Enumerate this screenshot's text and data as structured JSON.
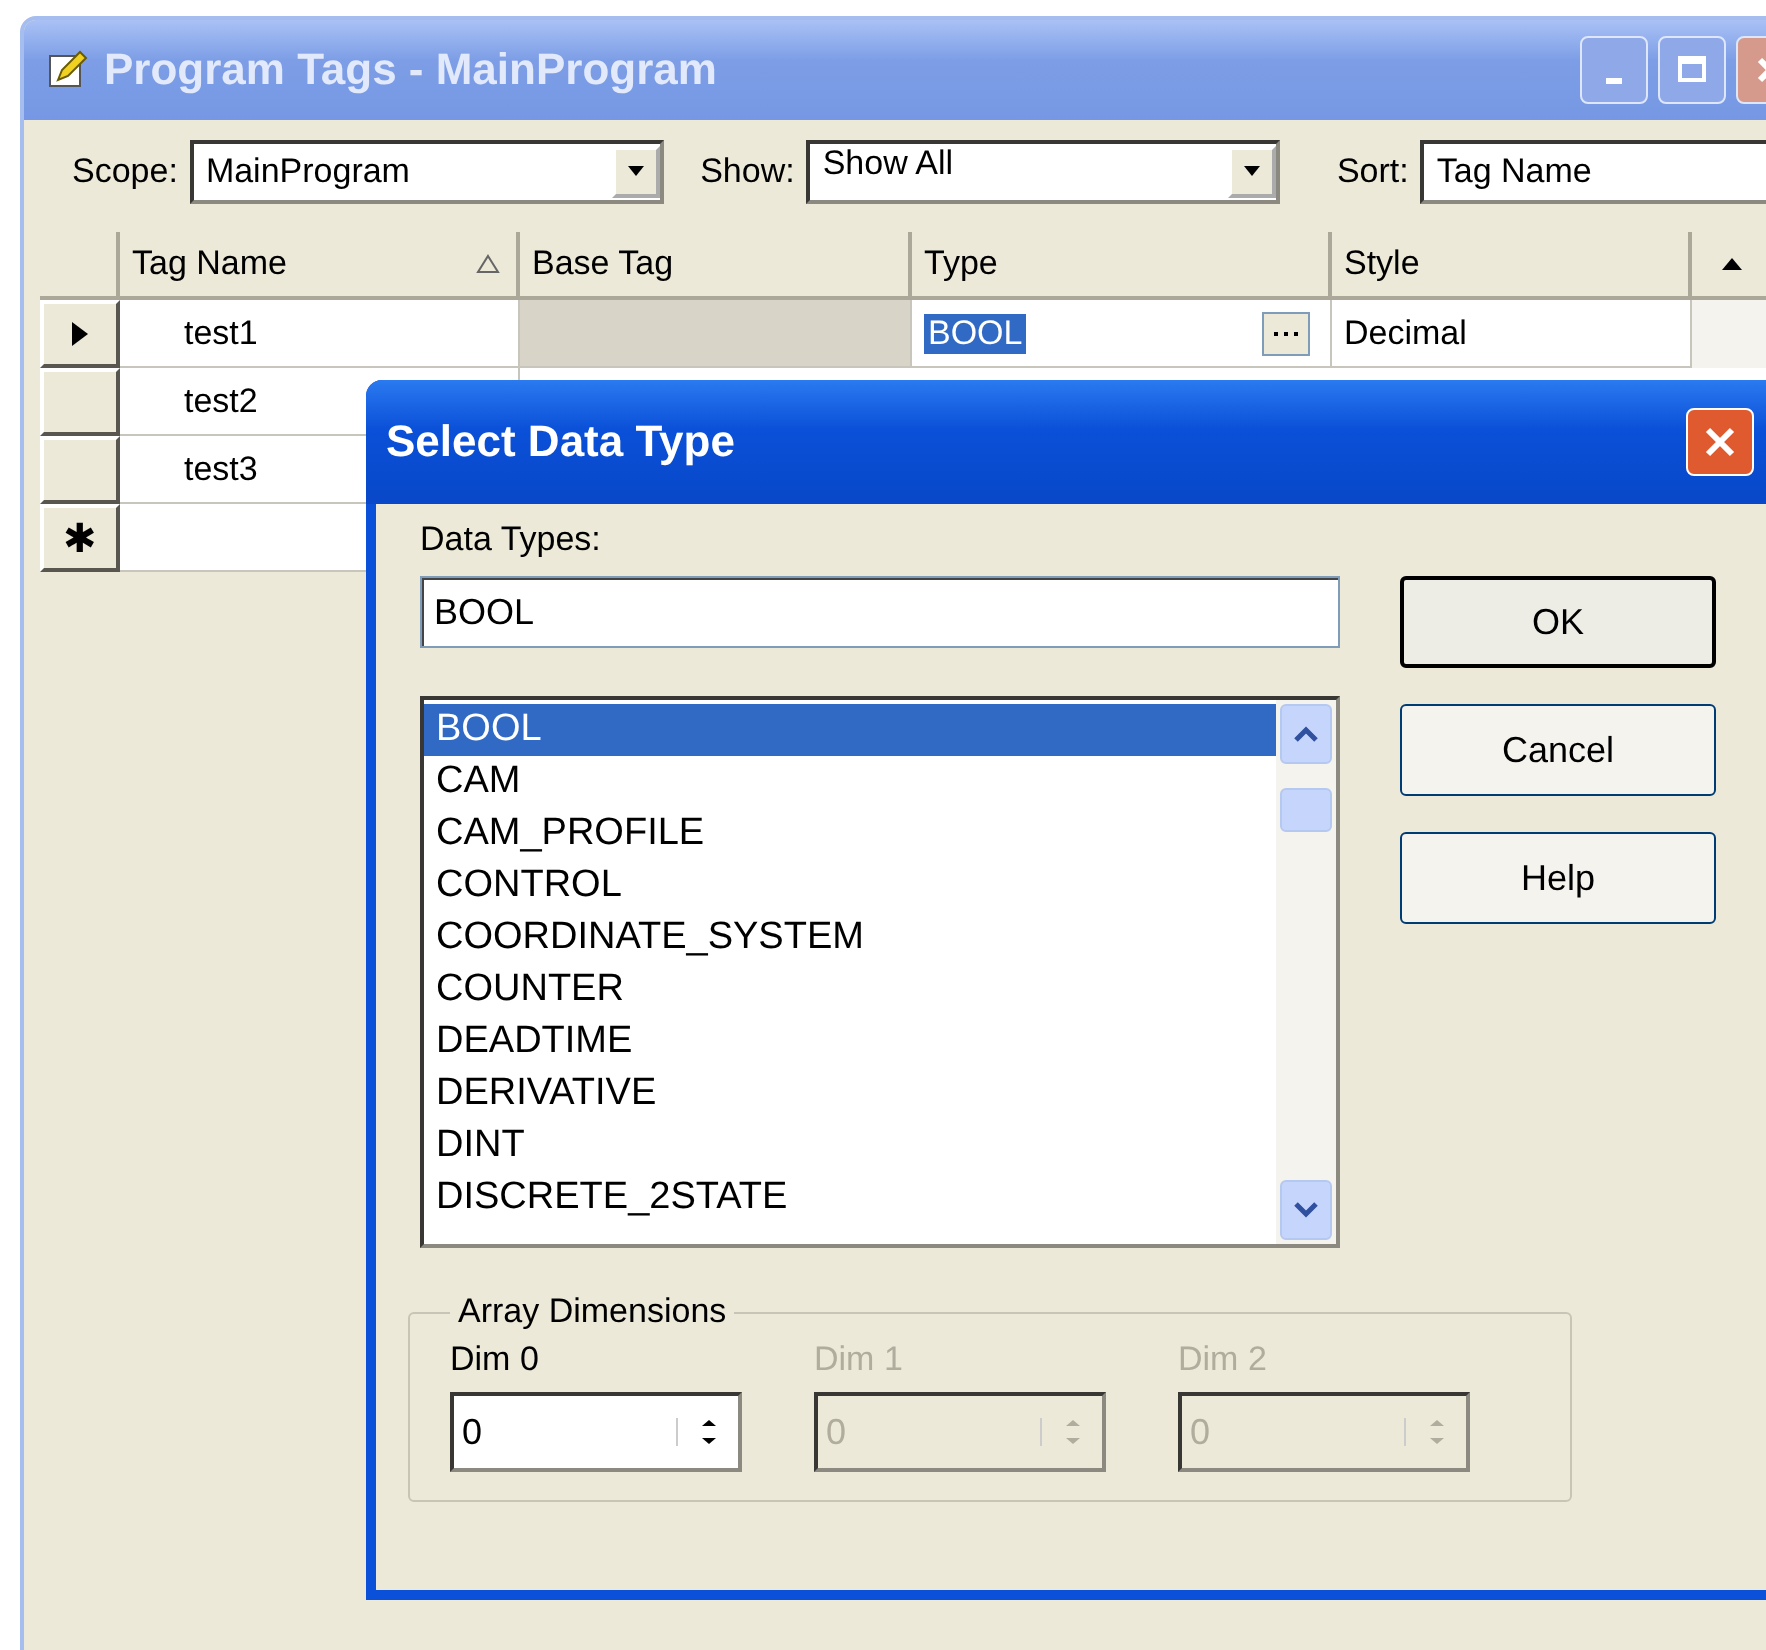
{
  "window": {
    "title": "Program Tags - MainProgram"
  },
  "toolbar": {
    "scope": {
      "label": "Scope:",
      "value": "MainProgram"
    },
    "show": {
      "label": "Show:",
      "value": "Show All"
    },
    "sort": {
      "label": "Sort:",
      "value": "Tag Name"
    }
  },
  "grid": {
    "columns": [
      {
        "label": "Tag Name",
        "sorted": true
      },
      {
        "label": "Base Tag",
        "sorted": false
      },
      {
        "label": "Type",
        "sorted": false
      },
      {
        "label": "Style",
        "sorted": false
      }
    ],
    "rows": [
      {
        "tag_name": "test1",
        "current": true,
        "base_tag_disabled": true,
        "type": "BOOL",
        "style": "Decimal"
      },
      {
        "tag_name": "test2",
        "current": false
      },
      {
        "tag_name": "test3",
        "current": false
      }
    ],
    "new_row_marker": "✱"
  },
  "dialog": {
    "title": "Select Data Type",
    "data_types_label": "Data Types:",
    "value": "BOOL",
    "items": [
      {
        "label": "BOOL",
        "selected": true
      },
      {
        "label": "CAM",
        "selected": false
      },
      {
        "label": "CAM_PROFILE",
        "selected": false
      },
      {
        "label": "CONTROL",
        "selected": false
      },
      {
        "label": "COORDINATE_SYSTEM",
        "selected": false
      },
      {
        "label": "COUNTER",
        "selected": false
      },
      {
        "label": "DEADTIME",
        "selected": false
      },
      {
        "label": "DERIVATIVE",
        "selected": false
      },
      {
        "label": "DINT",
        "selected": false
      },
      {
        "label": "DISCRETE_2STATE",
        "selected": false
      }
    ],
    "buttons": [
      {
        "label": "OK",
        "default": true
      },
      {
        "label": "Cancel",
        "default": false
      },
      {
        "label": "Help",
        "default": false
      }
    ],
    "array": {
      "title": "Array Dimensions",
      "dims": [
        {
          "label": "Dim 0",
          "value": "0",
          "disabled": false
        },
        {
          "label": "Dim 1",
          "value": "0",
          "disabled": true
        },
        {
          "label": "Dim 2",
          "value": "0",
          "disabled": true
        }
      ]
    }
  }
}
